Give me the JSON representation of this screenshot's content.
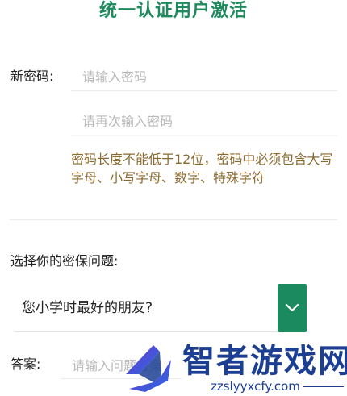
{
  "page": {
    "title": "统一认证用户激活"
  },
  "form": {
    "new_password_label": "新密码:",
    "new_password_value": "",
    "new_password_placeholder": "请输入密码",
    "confirm_password_value": "",
    "confirm_password_placeholder": "请再次输入密码",
    "password_hint": "密码长度不能低于12位，密码中必须包含大写字母、小写字母、数字、特殊字符",
    "security_question_label": "选择你的密保问题:",
    "security_question_selected": "您小学时最好的朋友?",
    "answer_label": "答案:",
    "answer_value": "",
    "answer_placeholder": "请输入问题答案"
  },
  "icons": {
    "dropdown": "chevron-down-icon",
    "watermark_logo": "watermark-logo-icon"
  },
  "colors": {
    "title": "#1f8a5e",
    "hint": "#8b6a2f",
    "dropdown_button": "#1b8a5f",
    "watermark": "#1c3f93"
  },
  "watermark": {
    "title": "智者游戏网",
    "url": "zzslyyxcfy.com"
  }
}
